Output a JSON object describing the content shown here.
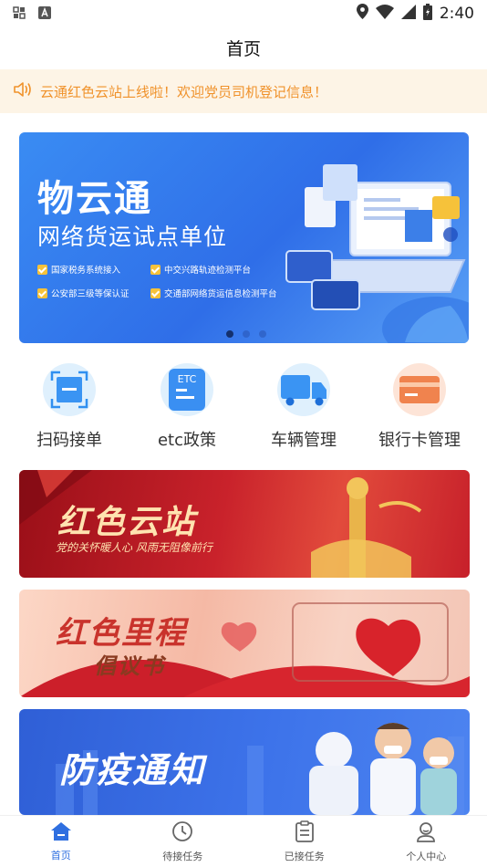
{
  "status_bar": {
    "time": "2:40",
    "left_icons": [
      "grid-notification-icon",
      "font-a-notification-icon"
    ],
    "right_icons": [
      "location-icon",
      "wifi-icon",
      "cell-signal-icon",
      "battery-icon"
    ]
  },
  "header": {
    "title": "首页"
  },
  "notice": {
    "icon": "speaker-icon",
    "text": "云通红色云站上线啦！欢迎党员司机登记信息！",
    "color": "#f0922b"
  },
  "banner": {
    "title": "物云通",
    "subtitle": "网络货运试点单位",
    "features": [
      "国家税务系统接入",
      "中交兴路轨迹检测平台",
      "公安部三级等保认证",
      "交通部网络货运信息检测平台"
    ],
    "page_count": 3,
    "current_page": 1
  },
  "quick_actions": [
    {
      "label": "扫码接单",
      "icon": "scan-icon"
    },
    {
      "label": "etc政策",
      "icon": "etc-card-icon",
      "icon_text": "ETC"
    },
    {
      "label": "车辆管理",
      "icon": "truck-icon"
    },
    {
      "label": "银行卡管理",
      "icon": "bank-card-icon"
    }
  ],
  "promos": [
    {
      "title": "红色云站",
      "subtitle": "党的关怀暖人心 风雨无阻像前行"
    },
    {
      "title": "红色里程",
      "subtitle": "倡议书"
    },
    {
      "title": "防疫通知",
      "subtitle": ""
    }
  ],
  "tabbar": {
    "items": [
      {
        "label": "首页",
        "icon": "home-icon",
        "active": true
      },
      {
        "label": "待接任务",
        "icon": "clock-icon",
        "active": false
      },
      {
        "label": "已接任务",
        "icon": "clipboard-icon",
        "active": false
      },
      {
        "label": "个人中心",
        "icon": "user-icon",
        "active": false
      }
    ],
    "active_color": "#2f6fe0"
  },
  "colors": {
    "brand_blue": "#2f6fe0",
    "notice_bg": "#fdf4e6",
    "promo_red": "#c8202b"
  }
}
